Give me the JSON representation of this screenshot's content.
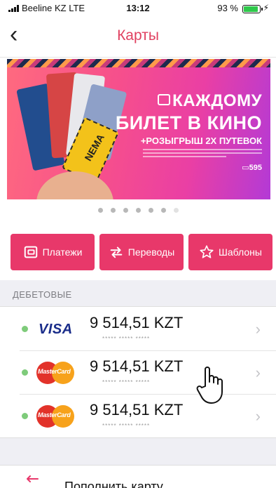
{
  "status_bar": {
    "carrier": "Beeline KZ  LTE",
    "time": "13:12",
    "battery": "93 %",
    "battery_level": 0.93,
    "charging_icon": "bolt-icon"
  },
  "nav": {
    "back_icon": "chevron-left-icon",
    "title": "Карты",
    "title_color": "#e04060"
  },
  "banner": {
    "line1": "КАЖДОМУ",
    "line2": "БИЛЕТ В КИНО",
    "line3": "+РОЗЫГРЫШ 2Х ПУТЕВОК",
    "code": "595",
    "ticket_text": "NEMA"
  },
  "carousel": {
    "count": 7,
    "active_index": 6
  },
  "actions": [
    {
      "label": "Платежи",
      "icon": "wallet-icon"
    },
    {
      "label": "Переводы",
      "icon": "transfer-arrows-icon"
    },
    {
      "label": "Шаблоны",
      "icon": "star-icon"
    }
  ],
  "accent_color": "#e8386a",
  "section": {
    "title": "ДЕБЕТОВЫЕ"
  },
  "cards": [
    {
      "brand": "VISA",
      "amount": "9 514,51 KZT",
      "number": "***** ***** *****",
      "status_color": "#7ecb7a"
    },
    {
      "brand": "MasterCard",
      "amount": "9 514,51 KZT",
      "number": "***** ***** *****",
      "status_color": "#7ecb7a"
    },
    {
      "brand": "MasterCard",
      "amount": "9 514,51 KZT",
      "number": "***** ***** *****",
      "status_color": "#7ecb7a"
    }
  ],
  "bottom_action": {
    "label": "Пополнить карту",
    "icon": "top-up-arrows-icon"
  }
}
